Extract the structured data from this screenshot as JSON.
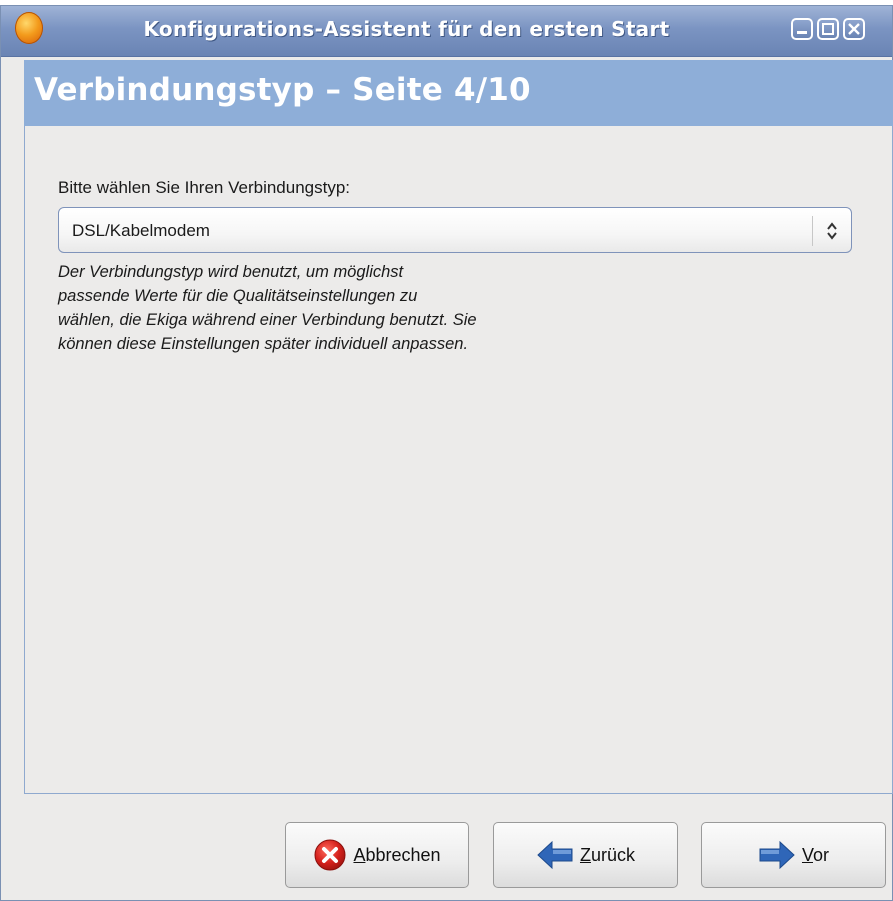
{
  "window": {
    "title": "Konfigurations-Assistent für den ersten Start"
  },
  "header": {
    "title": "Verbindungstyp – Seite 4/10"
  },
  "main": {
    "prompt_label": "Bitte wählen Sie Ihren Verbindungstyp:",
    "connection_type": {
      "selected": "DSL/Kabelmodem"
    },
    "description_lines": [
      "Der Verbindungstyp wird benutzt, um möglichst",
      "passende Werte für die Qualitätseinstellungen zu",
      "wählen, die Ekiga während einer Verbindung benutzt. Sie",
      "können diese Einstellungen später individuell anpassen."
    ]
  },
  "buttons": {
    "cancel": {
      "mnemonic": "A",
      "rest": "bbrechen"
    },
    "back": {
      "mnemonic": "Z",
      "rest": "urück"
    },
    "next": {
      "mnemonic": "V",
      "rest": "or"
    }
  },
  "icons": {
    "app": "ekiga-app-icon",
    "minimize": "minimize-icon",
    "maximize": "maximize-icon",
    "close": "close-icon",
    "combo_arrow": "updown-chevron-icon",
    "cancel": "red-x-circle-icon",
    "back": "arrow-left-icon",
    "next": "arrow-right-icon"
  },
  "colors": {
    "titlebar": "#7b94c2",
    "header_band": "#8eaed8",
    "window_bg": "#ecebea",
    "arrow_blue": "#2f66b8",
    "cancel_red": "#d4201b"
  }
}
